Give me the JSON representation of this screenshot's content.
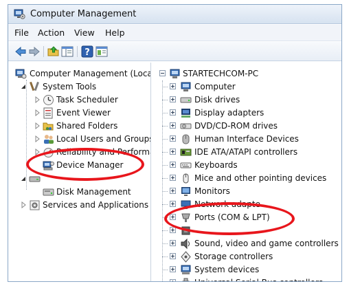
{
  "window": {
    "title": "Computer Management"
  },
  "menubar": {
    "items": [
      "File",
      "Action",
      "View",
      "Help"
    ]
  },
  "toolbar": {
    "buttons": [
      "back-arrow-icon",
      "forward-arrow-icon",
      "up-folder-icon",
      "show-hide-tree-icon",
      "help-icon",
      "properties-icon"
    ]
  },
  "left_tree": {
    "root": "Computer Management (Local",
    "system_tools": "System Tools",
    "task_scheduler": "Task Scheduler",
    "event_viewer": "Event Viewer",
    "shared_folders": "Shared Folders",
    "local_users": "Local Users and Groups",
    "reliability": "Reliability and Performa",
    "device_manager": "Device Manager",
    "disk_management": "Disk Management",
    "services": "Services and Applications"
  },
  "device_tree": {
    "root": "STARTECHCOM-PC",
    "items": [
      "Computer",
      "Disk drives",
      "Display adapters",
      "DVD/CD-ROM drives",
      "Human Interface Devices",
      "IDE ATA/ATAPI controllers",
      "Keyboards",
      "Mice and other pointing devices",
      "Monitors",
      "Network adapte",
      "Ports (COM & LPT)",
      "",
      "Sound, video and game controllers",
      "Storage controllers",
      "System devices",
      "Universal Serial Bus controllers"
    ]
  },
  "colors": {
    "highlight": "#e8161c",
    "accent": "#3a6fb5"
  }
}
